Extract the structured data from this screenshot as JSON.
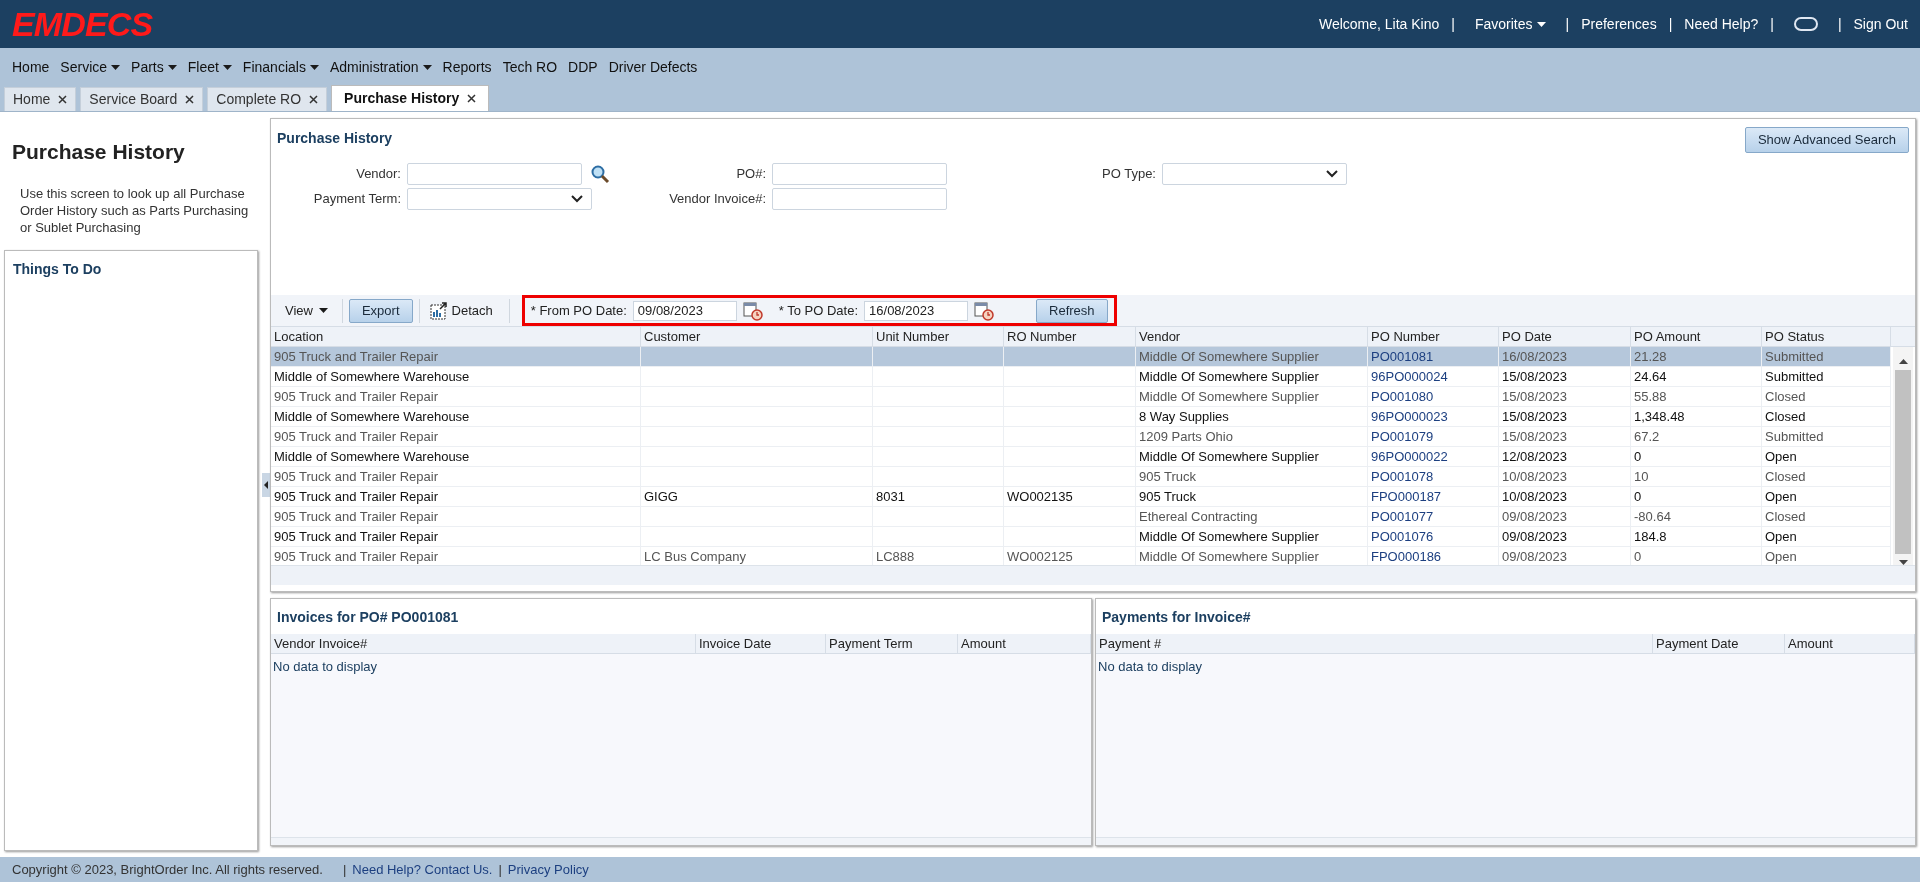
{
  "header": {
    "logo": "EMDECS",
    "separator": "|",
    "user_links": [
      {
        "kind": "text",
        "label": "Welcome, Lita Kino"
      },
      {
        "kind": "menu",
        "label": "Favorites"
      },
      {
        "kind": "link",
        "label": "Preferences"
      },
      {
        "kind": "link",
        "label": "Need Help?"
      },
      {
        "kind": "icon"
      },
      {
        "kind": "link",
        "label": "Sign Out"
      }
    ]
  },
  "menu": [
    {
      "label": "Home",
      "has_dropdown": false
    },
    {
      "label": "Service",
      "has_dropdown": true
    },
    {
      "label": "Parts",
      "has_dropdown": true
    },
    {
      "label": "Fleet",
      "has_dropdown": true
    },
    {
      "label": "Financials",
      "has_dropdown": true
    },
    {
      "label": "Administration",
      "has_dropdown": true
    },
    {
      "label": "Reports",
      "has_dropdown": false
    },
    {
      "label": "Tech RO",
      "has_dropdown": false
    },
    {
      "label": "DDP",
      "has_dropdown": false
    },
    {
      "label": "Driver Defects",
      "has_dropdown": false
    }
  ],
  "tabs": [
    {
      "label": "Home",
      "selected": false
    },
    {
      "label": "Service Board",
      "selected": false
    },
    {
      "label": "Complete RO",
      "selected": false
    },
    {
      "label": "Purchase History",
      "selected": true
    }
  ],
  "sidebar": {
    "title": "Purchase History",
    "description": "Use this screen to look up all Purchase Order History such as Parts Purchasing or Sublet Purchasing",
    "things_to_do": "Things To Do"
  },
  "search": {
    "title": "Purchase History",
    "advanced_button": "Show Advanced Search",
    "columns": [
      [
        {
          "label": "Vendor:",
          "kind": "lookup"
        },
        {
          "label": "Payment Term:",
          "kind": "select"
        }
      ],
      [
        {
          "label": "PO#:",
          "kind": "text"
        },
        {
          "label": "Vendor Invoice#:",
          "kind": "text"
        }
      ],
      [
        {
          "label": "PO Type:",
          "kind": "select"
        }
      ]
    ]
  },
  "toolbar": {
    "view": "View",
    "export": "Export",
    "detach": "Detach",
    "from_label": "* From PO Date:",
    "from_value": "09/08/2023",
    "to_label": "* To PO Date:",
    "to_value": "16/08/2023",
    "refresh": "Refresh"
  },
  "table": {
    "columns": [
      "Location",
      "Customer",
      "Unit Number",
      "RO Number",
      "Vendor",
      "PO Number",
      "PO Date",
      "PO Amount",
      "PO Status"
    ],
    "rows": [
      {
        "selected": true,
        "cells": [
          "905 Truck and Trailer Repair",
          "",
          "",
          "",
          "Middle Of Somewhere Supplier",
          "PO001081",
          "16/08/2023",
          "21.28",
          "Submitted"
        ]
      },
      {
        "selected": false,
        "cells": [
          "Middle of Somewhere Warehouse",
          "",
          "",
          "",
          "Middle Of Somewhere Supplier",
          "96PO000024",
          "15/08/2023",
          "24.64",
          "Submitted"
        ]
      },
      {
        "selected": false,
        "cells": [
          "905 Truck and Trailer Repair",
          "",
          "",
          "",
          "Middle Of Somewhere Supplier",
          "PO001080",
          "15/08/2023",
          "55.88",
          "Closed"
        ]
      },
      {
        "selected": false,
        "cells": [
          "Middle of Somewhere Warehouse",
          "",
          "",
          "",
          "8 Way Supplies",
          "96PO000023",
          "15/08/2023",
          "1,348.48",
          "Closed"
        ]
      },
      {
        "selected": false,
        "cells": [
          "905 Truck and Trailer Repair",
          "",
          "",
          "",
          "1209 Parts Ohio",
          "PO001079",
          "15/08/2023",
          "67.2",
          "Submitted"
        ]
      },
      {
        "selected": false,
        "cells": [
          "Middle of Somewhere Warehouse",
          "",
          "",
          "",
          "Middle Of Somewhere Supplier",
          "96PO000022",
          "12/08/2023",
          "0",
          "Open"
        ]
      },
      {
        "selected": false,
        "cells": [
          "905 Truck and Trailer Repair",
          "",
          "",
          "",
          "905 Truck",
          "PO001078",
          "10/08/2023",
          "10",
          "Closed"
        ]
      },
      {
        "selected": false,
        "cells": [
          "905 Truck and Trailer Repair",
          "GIGG",
          "8031",
          "WO002135",
          "905 Truck",
          "FPO000187",
          "10/08/2023",
          "0",
          "Open"
        ]
      },
      {
        "selected": false,
        "cells": [
          "905 Truck and Trailer Repair",
          "",
          "",
          "",
          "Ethereal Contracting",
          "PO001077",
          "09/08/2023",
          "-80.64",
          "Closed"
        ]
      },
      {
        "selected": false,
        "cells": [
          "905 Truck and Trailer Repair",
          "",
          "",
          "",
          "Middle Of Somewhere Supplier",
          "PO001076",
          "09/08/2023",
          "184.8",
          "Open"
        ]
      },
      {
        "selected": false,
        "cells": [
          "905 Truck and Trailer Repair",
          "LC Bus Company",
          "LC888",
          "WO002125",
          "Middle Of Somewhere Supplier",
          "FPO000186",
          "09/08/2023",
          "0",
          "Open"
        ]
      }
    ]
  },
  "invoices": {
    "title": "Invoices for PO# PO001081",
    "columns": [
      "Vendor Invoice#",
      "Invoice Date",
      "Payment Term",
      "Amount"
    ],
    "empty": "No data to display"
  },
  "payments": {
    "title": "Payments for Invoice#",
    "columns": [
      "Payment #",
      "Payment Date",
      "Amount"
    ],
    "empty": "No data to display"
  },
  "footer": {
    "separator": "|",
    "copyright": "Copyright © 2023, BrightOrder Inc. All rights reserved.",
    "links": [
      "Need Help? Contact Us.",
      "Privacy Policy"
    ]
  }
}
